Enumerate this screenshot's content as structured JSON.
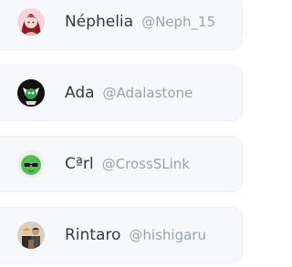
{
  "users": [
    {
      "name": "Néphelia",
      "handle": "@Neph_15",
      "avatar_icon": "anime-girl-avatar"
    },
    {
      "name": "Ada",
      "handle": "@Adalastone",
      "avatar_icon": "green-bot-avatar"
    },
    {
      "name": "Cªrl",
      "handle": "@CrossSLink",
      "avatar_icon": "sunglasses-avatar"
    },
    {
      "name": "Rintaro",
      "handle": "@hishigaru",
      "avatar_icon": "group-photo-avatar"
    }
  ]
}
